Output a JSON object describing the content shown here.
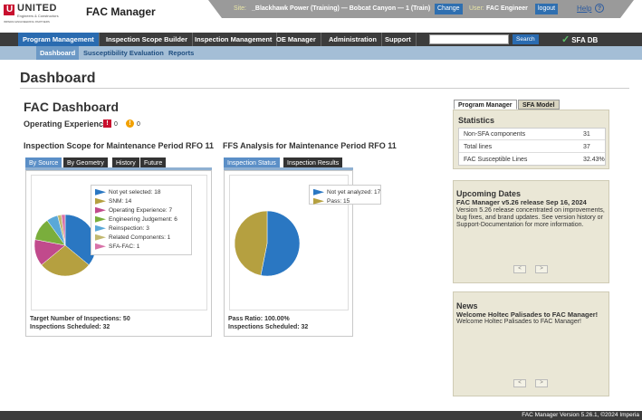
{
  "brand": {
    "name": "UNITED",
    "subtitle": "Engineers & Constructors",
    "tagline": "IMPERIA ENGINEERING PARTNERS",
    "app_title": "FAC Manager"
  },
  "site": {
    "label": "Site:",
    "value": "_Blackhawk Power (Training) — Bobcat Canyon — 1 (Train)",
    "change_label": "Change",
    "user_label": "User:",
    "user_value": "FAC Engineer",
    "logout_label": "logout",
    "help_label": "Help",
    "help_icon": "?"
  },
  "main_nav": {
    "items": [
      "Program Management",
      "Inspection Scope Builder",
      "Inspection Management",
      "OE Manager",
      "Administration",
      "Support"
    ],
    "search_placeholder": "",
    "search_label": "Search",
    "sfa_db_label": "SFA DB"
  },
  "sub_nav": {
    "items": [
      "Dashboard",
      "Susceptibility Evaluation",
      "Reports"
    ]
  },
  "page": {
    "title": "Dashboard",
    "dash_title": "FAC Dashboard",
    "op_exp_label": "Operating Experience",
    "op_red_icon": "!",
    "op_red_count": "0",
    "op_orange_icon": "!",
    "op_orange_count": "0"
  },
  "scope": {
    "title": "Inspection Scope for Maintenance Period RFO 11",
    "tabs": [
      "By Source",
      "By Geometry",
      "History",
      "Future"
    ],
    "legend": [
      {
        "label": "Not yet selected: 18",
        "color": "#2a77c2"
      },
      {
        "label": "SNM: 14",
        "color": "#b5a040"
      },
      {
        "label": "Operating Experience: 7",
        "color": "#c14a8c"
      },
      {
        "label": "Engineering Judgement: 6",
        "color": "#7aae3c"
      },
      {
        "label": "Reinspection: 3",
        "color": "#5aa8d8"
      },
      {
        "label": "Related Components: 1",
        "color": "#c2b870"
      },
      {
        "label": "SFA-FAC: 1",
        "color": "#d872a8"
      }
    ],
    "target_line": "Target Number of Inspections: 50",
    "scheduled_line": "Inspections Scheduled: 32"
  },
  "ffs": {
    "title": "FFS Analysis for Maintenance Period RFO 11",
    "tabs": [
      "Inspection Status",
      "Inspection Results"
    ],
    "legend": [
      {
        "label": "Not yet analyzed: 17",
        "color": "#2a77c2"
      },
      {
        "label": "Pass: 15",
        "color": "#b5a040"
      }
    ],
    "pass_line": "Pass Ratio: 100.00%",
    "scheduled_line": "Inspections Scheduled: 32"
  },
  "right": {
    "tabs": [
      "Program Manager",
      "SFA Model"
    ],
    "statistics": {
      "title": "Statistics",
      "rows": [
        {
          "k": "Non-SFA components",
          "v": "31"
        },
        {
          "k": "Total lines",
          "v": "37"
        },
        {
          "k": "FAC Susceptible Lines",
          "v": "32.43%"
        }
      ]
    },
    "upcoming": {
      "title": "Upcoming Dates",
      "headline": "FAC Manager v5.26 release Sep 16, 2024",
      "body": "Version 5.26 release concentrated on improvements, bug fixes, and brand updates. See version history or Support-Documentation for more information.",
      "prev": "<",
      "next": ">"
    },
    "news": {
      "title": "News",
      "headline": "Welcome Holtec Palisades to FAC Manager!",
      "body": "Welcome Holtec Palisades to FAC Manager!",
      "prev": "<",
      "next": ">"
    }
  },
  "footer": {
    "text": "FAC Manager Version 5.26.1, ©2024 Imperia"
  },
  "chart_data": [
    {
      "type": "pie",
      "categories": [
        "Not yet selected",
        "SNM",
        "Operating Experience",
        "Engineering Judgement",
        "Reinspection",
        "Related Components",
        "SFA-FAC"
      ],
      "values": [
        18,
        14,
        7,
        6,
        3,
        1,
        1
      ]
    },
    {
      "type": "pie",
      "categories": [
        "Not yet analyzed",
        "Pass"
      ],
      "values": [
        17,
        15
      ]
    }
  ]
}
